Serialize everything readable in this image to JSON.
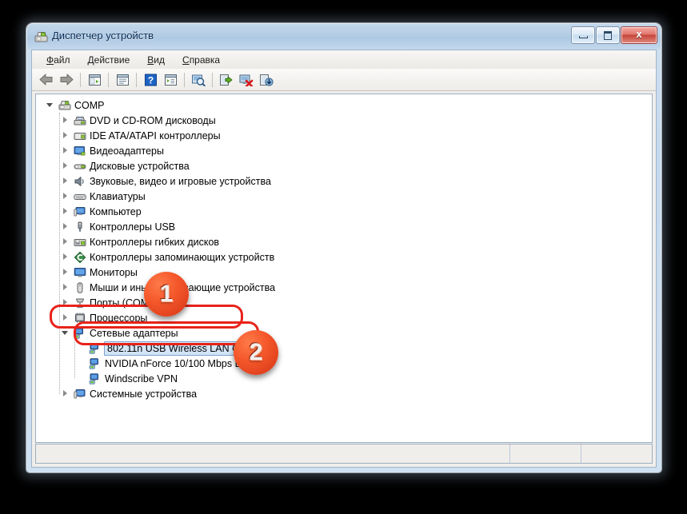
{
  "window": {
    "title": "Диспетчер устройств",
    "title_icon": "device-manager-icon",
    "buttons": {
      "minimize": "minimize-icon",
      "maximize": "maximize-icon",
      "close": "x"
    }
  },
  "menu": {
    "items": [
      {
        "accel": "Ф",
        "rest": "айл"
      },
      {
        "accel": "Д",
        "rest": "ействие"
      },
      {
        "accel": "В",
        "rest": "ид"
      },
      {
        "accel": "С",
        "rest": "правка"
      }
    ]
  },
  "toolbar": {
    "items": [
      {
        "name": "back-button",
        "icon": "left-arrow-icon"
      },
      {
        "name": "forward-button",
        "icon": "right-arrow-icon"
      },
      {
        "name": "separator-1",
        "icon": "separator"
      },
      {
        "name": "show-hide-console-tree-button",
        "icon": "console-tree-icon"
      },
      {
        "name": "separator-2",
        "icon": "separator"
      },
      {
        "name": "properties-button",
        "icon": "properties-icon"
      },
      {
        "name": "separator-3",
        "icon": "separator"
      },
      {
        "name": "help-button",
        "icon": "question-mark-icon"
      },
      {
        "name": "view-button",
        "icon": "view-list-icon"
      },
      {
        "name": "separator-4",
        "icon": "separator"
      },
      {
        "name": "scan-hardware-changes-button",
        "icon": "scan-magnifier-icon"
      },
      {
        "name": "separator-5",
        "icon": "separator"
      },
      {
        "name": "update-driver-button",
        "icon": "update-driver-icon"
      },
      {
        "name": "uninstall-device-button",
        "icon": "uninstall-device-icon"
      },
      {
        "name": "disable-device-button",
        "icon": "disable-device-icon"
      }
    ]
  },
  "tree": {
    "root": {
      "label": "COMP",
      "icon": "computer-root-icon",
      "expanded": true
    },
    "nodes": [
      {
        "label": "DVD и CD-ROM дисководы",
        "icon": "dvd-drive-icon",
        "expander": "closed",
        "level": 1
      },
      {
        "label": "IDE ATA/ATAPI контроллеры",
        "icon": "ide-controller-icon",
        "expander": "closed",
        "level": 1
      },
      {
        "label": "Видеоадаптеры",
        "icon": "display-adapter-icon",
        "expander": "closed",
        "level": 1
      },
      {
        "label": "Дисковые устройства",
        "icon": "disk-drive-icon",
        "expander": "closed",
        "level": 1
      },
      {
        "label": "Звуковые, видео и игровые устройства",
        "icon": "sound-device-icon",
        "expander": "closed",
        "level": 1
      },
      {
        "label": "Клавиатуры",
        "icon": "keyboard-icon",
        "expander": "closed",
        "level": 1
      },
      {
        "label": "Компьютер",
        "icon": "computer-icon",
        "expander": "closed",
        "level": 1
      },
      {
        "label": "Контроллеры USB",
        "icon": "usb-controller-icon",
        "expander": "closed",
        "level": 1
      },
      {
        "label": "Контроллеры гибких дисков",
        "icon": "floppy-controller-icon",
        "expander": "closed",
        "level": 1
      },
      {
        "label": "Контроллеры запоминающих устройств",
        "icon": "storage-controller-icon",
        "expander": "closed",
        "level": 1
      },
      {
        "label": "Мониторы",
        "icon": "monitor-icon",
        "expander": "closed",
        "level": 1
      },
      {
        "label": "Мыши и иные указывающие устройства",
        "icon": "mouse-icon",
        "expander": "closed",
        "level": 1
      },
      {
        "label": "Порты (COM и LPT)",
        "icon": "port-icon",
        "expander": "closed",
        "level": 1
      },
      {
        "label": "Процессоры",
        "icon": "processor-icon",
        "expander": "closed",
        "level": 1
      },
      {
        "label": "Сетевые адаптеры",
        "icon": "network-adapter-icon",
        "expander": "open",
        "level": 1,
        "highlighted": true
      },
      {
        "label": "802.11n USB Wireless LAN Card",
        "icon": "network-device-icon",
        "expander": "none",
        "level": 2,
        "selected": true,
        "highlighted": true
      },
      {
        "label": "NVIDIA nForce 10/100 Mbps Ethernet",
        "icon": "network-device-icon",
        "expander": "none",
        "level": 2
      },
      {
        "label": "Windscribe VPN",
        "icon": "network-device-icon",
        "expander": "none",
        "level": 2
      },
      {
        "label": "Системные устройства",
        "icon": "system-device-icon",
        "expander": "closed",
        "level": 1
      }
    ]
  },
  "status_bar": {
    "panes": [
      "",
      "",
      ""
    ]
  },
  "annotations": {
    "markers": [
      {
        "label": "1",
        "name": "step-marker-1"
      },
      {
        "label": "2",
        "name": "step-marker-2"
      }
    ],
    "highlight_color": "#e8231a",
    "marker_color": "#f4572a"
  }
}
